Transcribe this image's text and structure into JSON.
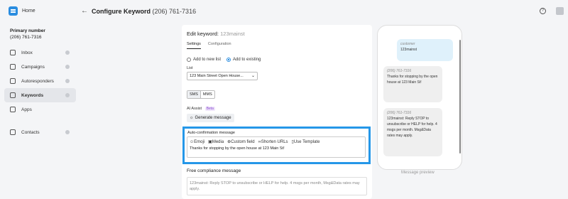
{
  "sidebar": {
    "home": "Home",
    "primary_label": "Primary number",
    "primary_number": "(206) 761-7316",
    "items": [
      {
        "label": "Inbox",
        "icon": "inbox-icon"
      },
      {
        "label": "Campaigns",
        "icon": "campaigns-icon"
      },
      {
        "label": "Autoresponders",
        "icon": "autoresponders-icon"
      },
      {
        "label": "Keywords",
        "icon": "key-icon",
        "active": true
      },
      {
        "label": "Apps",
        "icon": "apps-icon"
      },
      {
        "label": "Contacts",
        "icon": "contacts-icon"
      }
    ]
  },
  "header": {
    "back": "←",
    "title": "Configure Keyword",
    "phone": "(206) 761-7316",
    "help": "?"
  },
  "editor": {
    "title": "Edit keyword:",
    "keyword": "123mainst",
    "tabs": [
      "Settings",
      "Configuration"
    ],
    "radio_new": "Add to new list",
    "radio_existing": "Add to existing",
    "list_label": "List",
    "list_value": "123 Main Street Open House...",
    "seg_sms": "SMS",
    "seg_mms": "MMS",
    "ai_label": "AI Assist",
    "beta": "Beta",
    "generate": "Generate message",
    "auto_label": "Auto-confirmation message",
    "toolbar": {
      "emoji": "Emoji",
      "media": "Media",
      "custom": "Custom field",
      "shorten": "Shorten URLs",
      "template": "Use Template"
    },
    "auto_text": "Thanks for stopping by the open house at 123 Main St!",
    "free_label": "Free compliance message",
    "free_text": "123mainst: Reply STOP to unsubscribe or HELP for help. 4 msgs per month, Msg&Data rates may apply."
  },
  "preview": {
    "b1_meta": "customer",
    "b1_text": "123mainst",
    "b2_meta": "(206) 761-7316",
    "b2_text": "Thanks for stopping by the open house at 123 Main St!",
    "b3_meta": "(206) 761-7316",
    "b3_text": "123mainst: Reply STOP to unsubscribe or HELP for help. 4 msgs per month. Msg&Data rates may apply.",
    "label": "Message preview"
  },
  "colors": {
    "accent": "#2a8de0",
    "highlight": "#2597e8"
  }
}
